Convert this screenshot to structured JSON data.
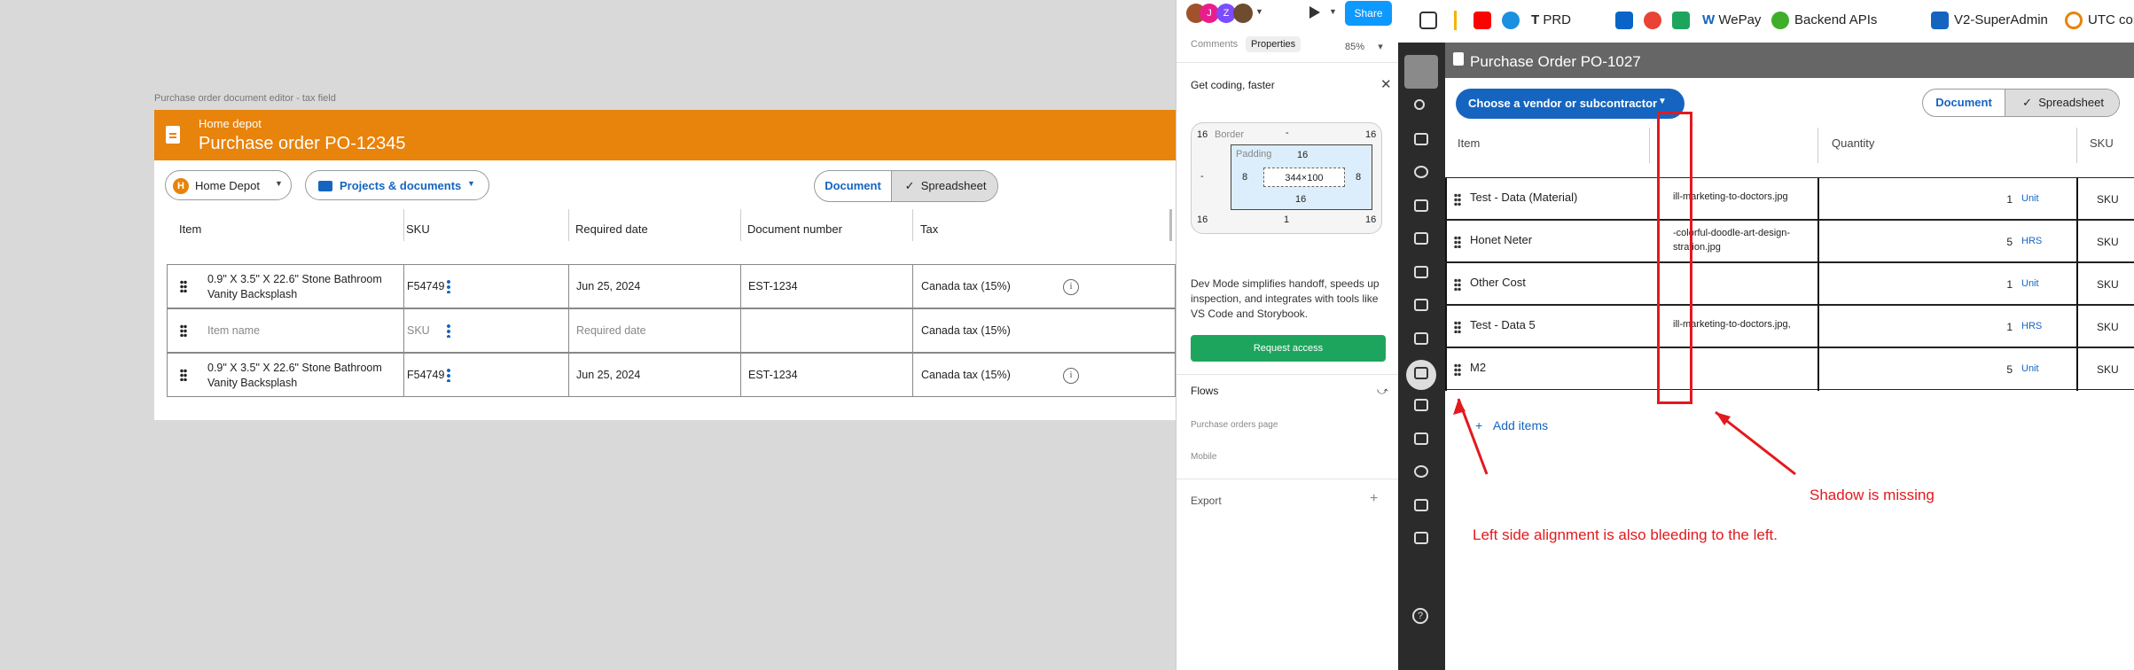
{
  "editor": {
    "frame_label": "Purchase order document editor - tax field",
    "vendor": "Home depot",
    "title": "Purchase order PO-12345",
    "vendor_select": "Home Depot",
    "vendor_initial": "H",
    "projects_button": "Projects & documents",
    "view_toggle": {
      "document": "Document",
      "spreadsheet": "Spreadsheet",
      "check": "✓"
    },
    "columns": [
      "Item",
      "SKU",
      "Required date",
      "Document number",
      "Tax"
    ],
    "rows": [
      {
        "item": "0.9\" X 3.5\" X 22.6\" Stone Bathroom Vanity Backsplash",
        "sku": "F54749",
        "date": "Jun 25, 2024",
        "doc": "EST-1234",
        "tax": "Canada tax (15%)",
        "placeholder": false
      },
      {
        "item": "Item name",
        "sku": "SKU",
        "date": "Required date",
        "doc": "",
        "tax": "Canada tax (15%)",
        "placeholder": true
      },
      {
        "item": "0.9\" X 3.5\" X 22.6\" Stone Bathroom Vanity Backsplash",
        "sku": "F54749",
        "date": "Jun 25, 2024",
        "doc": "EST-1234",
        "tax": "Canada tax (15%)",
        "placeholder": false
      }
    ]
  },
  "figma": {
    "avatars": [
      "J",
      "Z"
    ],
    "share": "Share",
    "tabs": {
      "comments": "Comments",
      "properties": "Properties"
    },
    "zoom": "85%",
    "get_coding": "Get coding, faster",
    "box_model": {
      "border_label": "Border",
      "border_dash": "-",
      "padding_label": "Padding",
      "outer": "16",
      "pad_top": "16",
      "pad_side": "8",
      "pad_bottom": "16",
      "size": "344×100",
      "outer_bottom": "1",
      "side_dash": "-"
    },
    "devmode_text": "Dev Mode simplifies handoff, speeds up inspection, and integrates with tools like VS Code and Storybook.",
    "request_access": "Request access",
    "flows": "Flows",
    "flow_items": [
      "Purchase orders page",
      "Mobile"
    ],
    "export": "Export",
    "export_plus": "+"
  },
  "bookmarks": [
    "PRD",
    "WePay",
    "Backend APIs",
    "V2-SuperAdmin",
    "UTC con"
  ],
  "app": {
    "title": "Purchase Order PO-1027",
    "vendor_button": "Choose a vendor or subcontractor",
    "view_toggle": {
      "document": "Document",
      "spreadsheet": "Spreadsheet",
      "check": "✓"
    },
    "columns": [
      "Item",
      "Quantity",
      "SKU"
    ],
    "rows": [
      {
        "item": "Test - Data (Material)",
        "file": "ill-marketing-to-doctors.jpg",
        "qty": "1",
        "unit": "Unit",
        "sku": "SKU"
      },
      {
        "item": "Honet Neter",
        "file": "-colorful-doodle-art-design-stration.jpg",
        "qty": "5",
        "unit": "HRS",
        "sku": "SKU"
      },
      {
        "item": "Other Cost",
        "file": "",
        "qty": "1",
        "unit": "Unit",
        "sku": "SKU"
      },
      {
        "item": "Test - Data 5",
        "file": "ill-marketing-to-doctors.jpg,",
        "qty": "1",
        "unit": "HRS",
        "sku": "SKU"
      },
      {
        "item": "M2",
        "file": "",
        "qty": "5",
        "unit": "Unit",
        "sku": "SKU"
      }
    ],
    "add_items": "Add items"
  },
  "annotations": {
    "shadow": "Shadow is missing",
    "alignment": "Left side alignment is also bleeding to the left."
  },
  "colors": {
    "brand_orange": "#e8830c",
    "primary_blue": "#1565c0",
    "annotation_red": "#e3191e"
  }
}
